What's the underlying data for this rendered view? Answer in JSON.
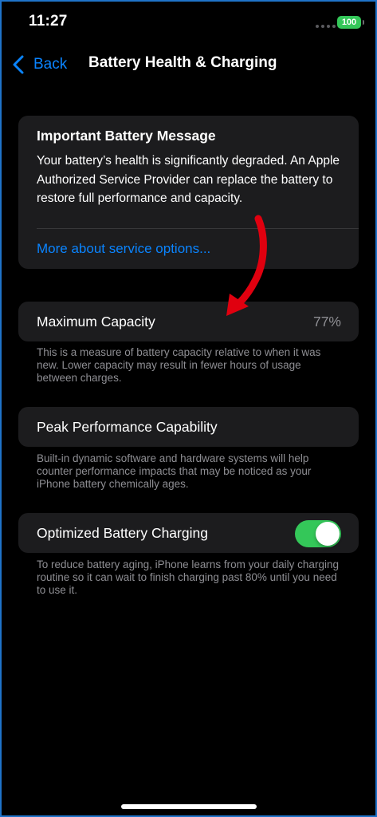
{
  "status_bar": {
    "time": "11:27",
    "battery_level": "100",
    "battery_color": "#34c759"
  },
  "nav": {
    "back_label": "Back",
    "title": "Battery Health & Charging",
    "accent_color": "#0a84ff"
  },
  "battery_message": {
    "title": "Important Battery Message",
    "body": "Your battery’s health is significantly degraded. An Apple Authorized Service Provider can replace the battery to restore full performance and capacity.",
    "link": "More about service options..."
  },
  "maximum_capacity": {
    "label": "Maximum Capacity",
    "value": "77%",
    "footnote": "This is a measure of battery capacity relative to when it was new. Lower capacity may result in fewer hours of usage between charges."
  },
  "peak_performance": {
    "label": "Peak Performance Capability",
    "footnote": "Built-in dynamic software and hardware systems will help counter performance impacts that may be noticed as your iPhone battery chemically ages."
  },
  "optimized_charging": {
    "label": "Optimized Battery Charging",
    "enabled": true,
    "footnote": "To reduce battery aging, iPhone learns from your daily charging routine so it can wait to finish charging past 80% until you need to use it."
  },
  "icons": {
    "back": "chevron-left-icon",
    "annotation": "red-curved-arrow-icon",
    "annotation_color": "#e0000f"
  }
}
